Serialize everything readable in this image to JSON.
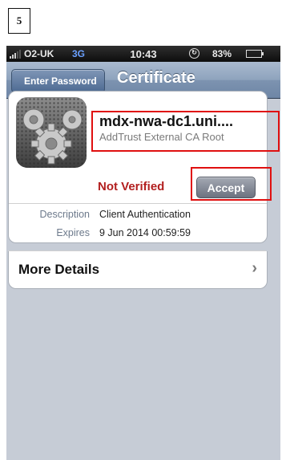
{
  "step": "5",
  "status_bar": {
    "carrier": "O2-UK",
    "network": "3G",
    "time": "10:43",
    "battery": "83%",
    "battery_level": 0.83,
    "battery_color": "#43d23a"
  },
  "nav": {
    "back_label": "Enter Password",
    "title": "Certificate"
  },
  "certificate": {
    "name": "mdx-nwa-dc1.uni....",
    "issuer": "AddTrust External CA Root",
    "status": "Not Verified",
    "status_color": "#b21f1f",
    "accept_label": "Accept",
    "icon": "settings-gears-icon"
  },
  "details": {
    "description_label": "Description",
    "description_value": "Client Authentication",
    "expires_label": "Expires",
    "expires_value": "9 Jun 2014 00:59:59"
  },
  "more_details_label": "More Details",
  "highlight_color": "#e01010"
}
